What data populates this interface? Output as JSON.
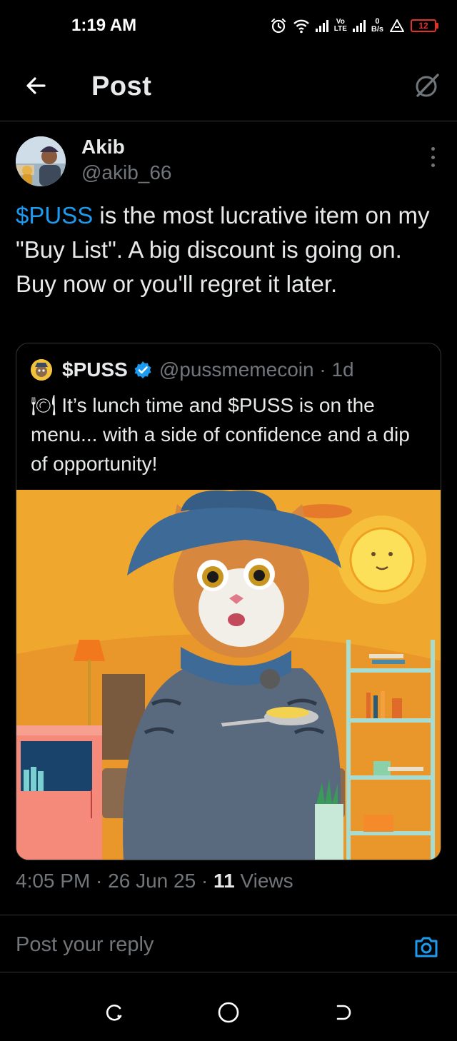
{
  "status_bar": {
    "time": "1:19 AM",
    "lte_top": "Vo",
    "lte_bottom": "LTE",
    "speed_value": "0",
    "speed_unit": "B/s",
    "battery": "12",
    "battery_color": "#e0322b"
  },
  "header": {
    "title": "Post",
    "back_icon": "arrow-left-icon",
    "grok_icon": "grok-icon"
  },
  "post": {
    "author_name": "Akib",
    "author_handle": "@akib_66",
    "text_cashtag": "$PUSS",
    "text_rest": " is the most lucrative item on my \"Buy List\". A big discount is going on. Buy now or you'll regret it later.",
    "timestamp": "4:05 PM · 26 Jun 25 · ",
    "views_count": "11",
    "views_label": " Views"
  },
  "quote": {
    "name": "$PUSS",
    "handle": "@pussmemecoin · 1d",
    "text": "🍽 It’s lunch time and $PUSS is on the menu... with a side of confidence and a dip of opportunity!"
  },
  "reply": {
    "placeholder": "Post your reply"
  },
  "colors": {
    "background": "#000000",
    "accent": "#1d9bf0",
    "muted": "#71767b",
    "text": "#e7e9ea"
  }
}
